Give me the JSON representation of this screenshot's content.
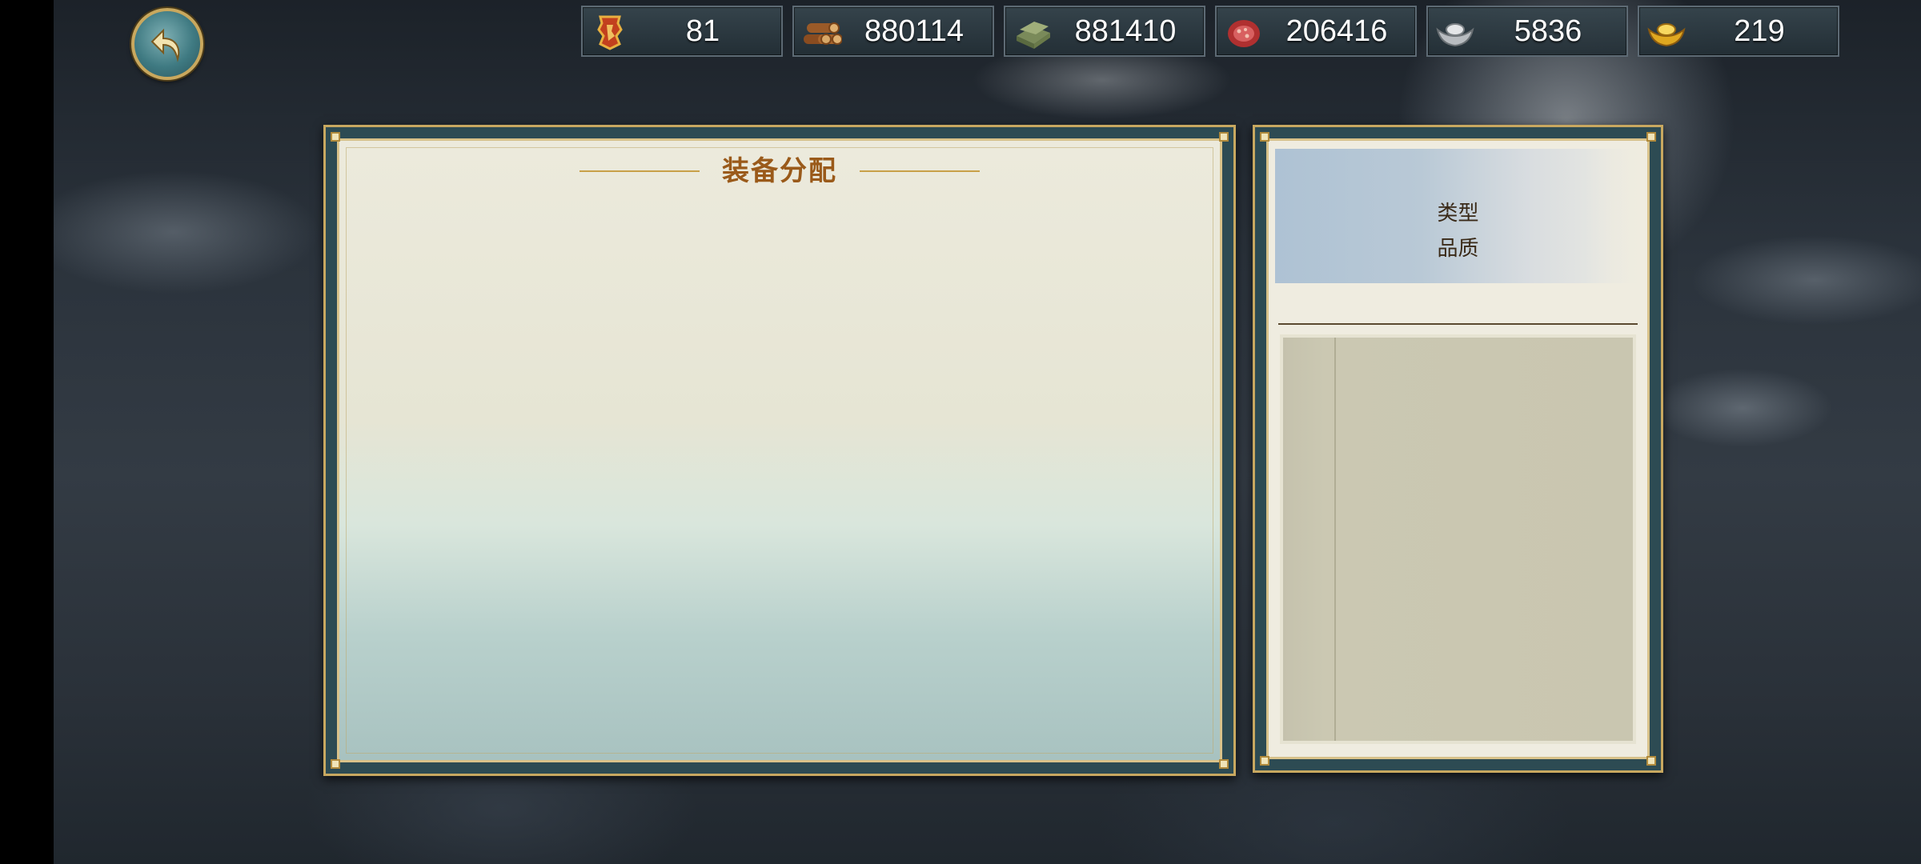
{
  "resources": [
    {
      "icon": "scroll-badge-icon",
      "value": "81"
    },
    {
      "icon": "wood-logs-icon",
      "value": "880114"
    },
    {
      "icon": "stone-slab-icon",
      "value": "881410"
    },
    {
      "icon": "meat-icon",
      "value": "206416"
    },
    {
      "icon": "silver-ingot-icon",
      "value": "5836"
    },
    {
      "icon": "gold-ingot-icon",
      "value": "219"
    }
  ],
  "main_panel": {
    "title": "装备分配"
  },
  "side_panel": {
    "type_label": "类型",
    "quality_label": "品质"
  },
  "colors": {
    "title": "#9a5a1a",
    "frame_gold": "#c8a860",
    "frame_teal": "#2d4b53"
  }
}
